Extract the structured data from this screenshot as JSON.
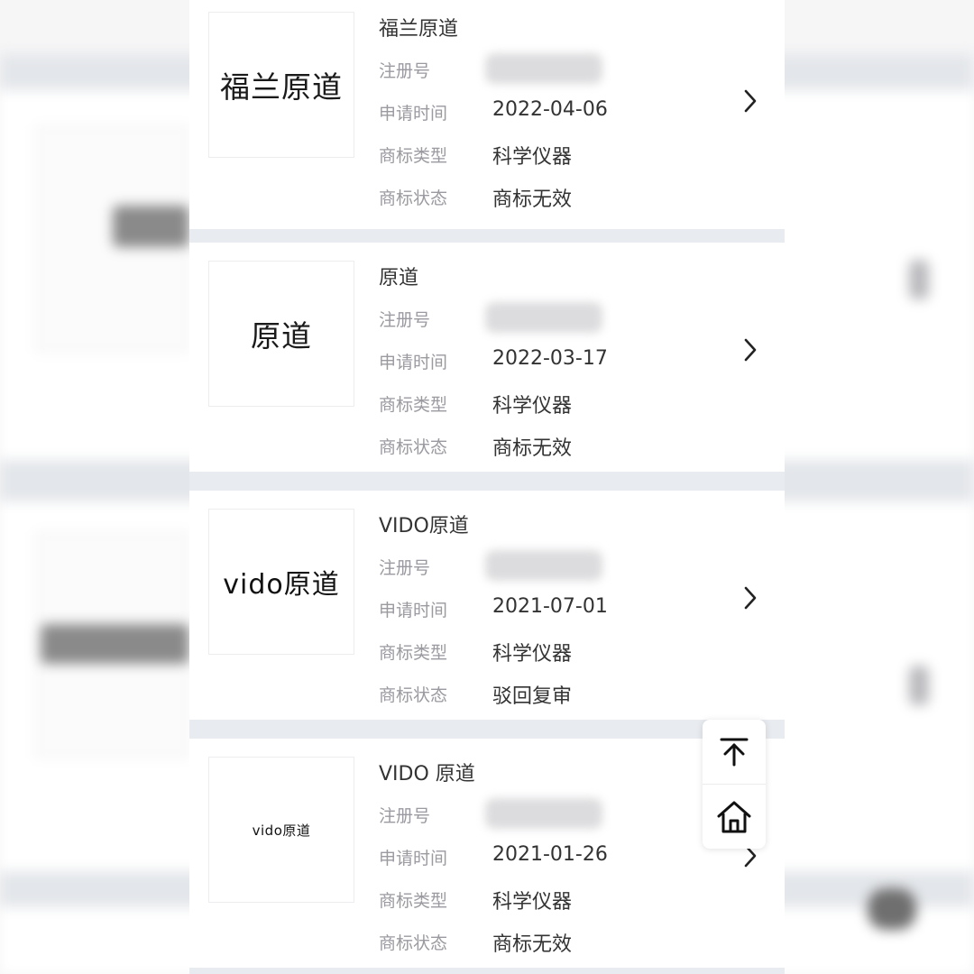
{
  "items": [
    {
      "name": "福兰原道",
      "logo_text": "福兰原道",
      "reg_label": "注册号",
      "date_label": "申请时间",
      "date": "2022-04-06",
      "type_label": "商标类型",
      "type": "科学仪器",
      "status_label": "商标状态",
      "status": "商标无效"
    },
    {
      "name": "原道",
      "logo_text": "原道",
      "reg_label": "注册号",
      "date_label": "申请时间",
      "date": "2022-03-17",
      "type_label": "商标类型",
      "type": "科学仪器",
      "status_label": "商标状态",
      "status": "商标无效"
    },
    {
      "name": "VIDO原道",
      "logo_text": "vido原道",
      "reg_label": "注册号",
      "date_label": "申请时间",
      "date": "2021-07-01",
      "type_label": "商标类型",
      "type": "科学仪器",
      "status_label": "商标状态",
      "status": "驳回复审"
    },
    {
      "name": "VIDO 原道",
      "logo_text": "vido原道",
      "reg_label": "注册号",
      "date_label": "申请时间",
      "date": "2021-01-26",
      "type_label": "商标类型",
      "type": "科学仪器",
      "status_label": "商标状态",
      "status": "商标无效"
    }
  ],
  "icons": {
    "chevron": "chevron-right-icon",
    "back_to_top": "arrow-up-to-top-icon",
    "home": "home-icon"
  },
  "colors": {
    "label": "#9a9aa0",
    "value": "#333333",
    "separator": "#e8ebef"
  }
}
